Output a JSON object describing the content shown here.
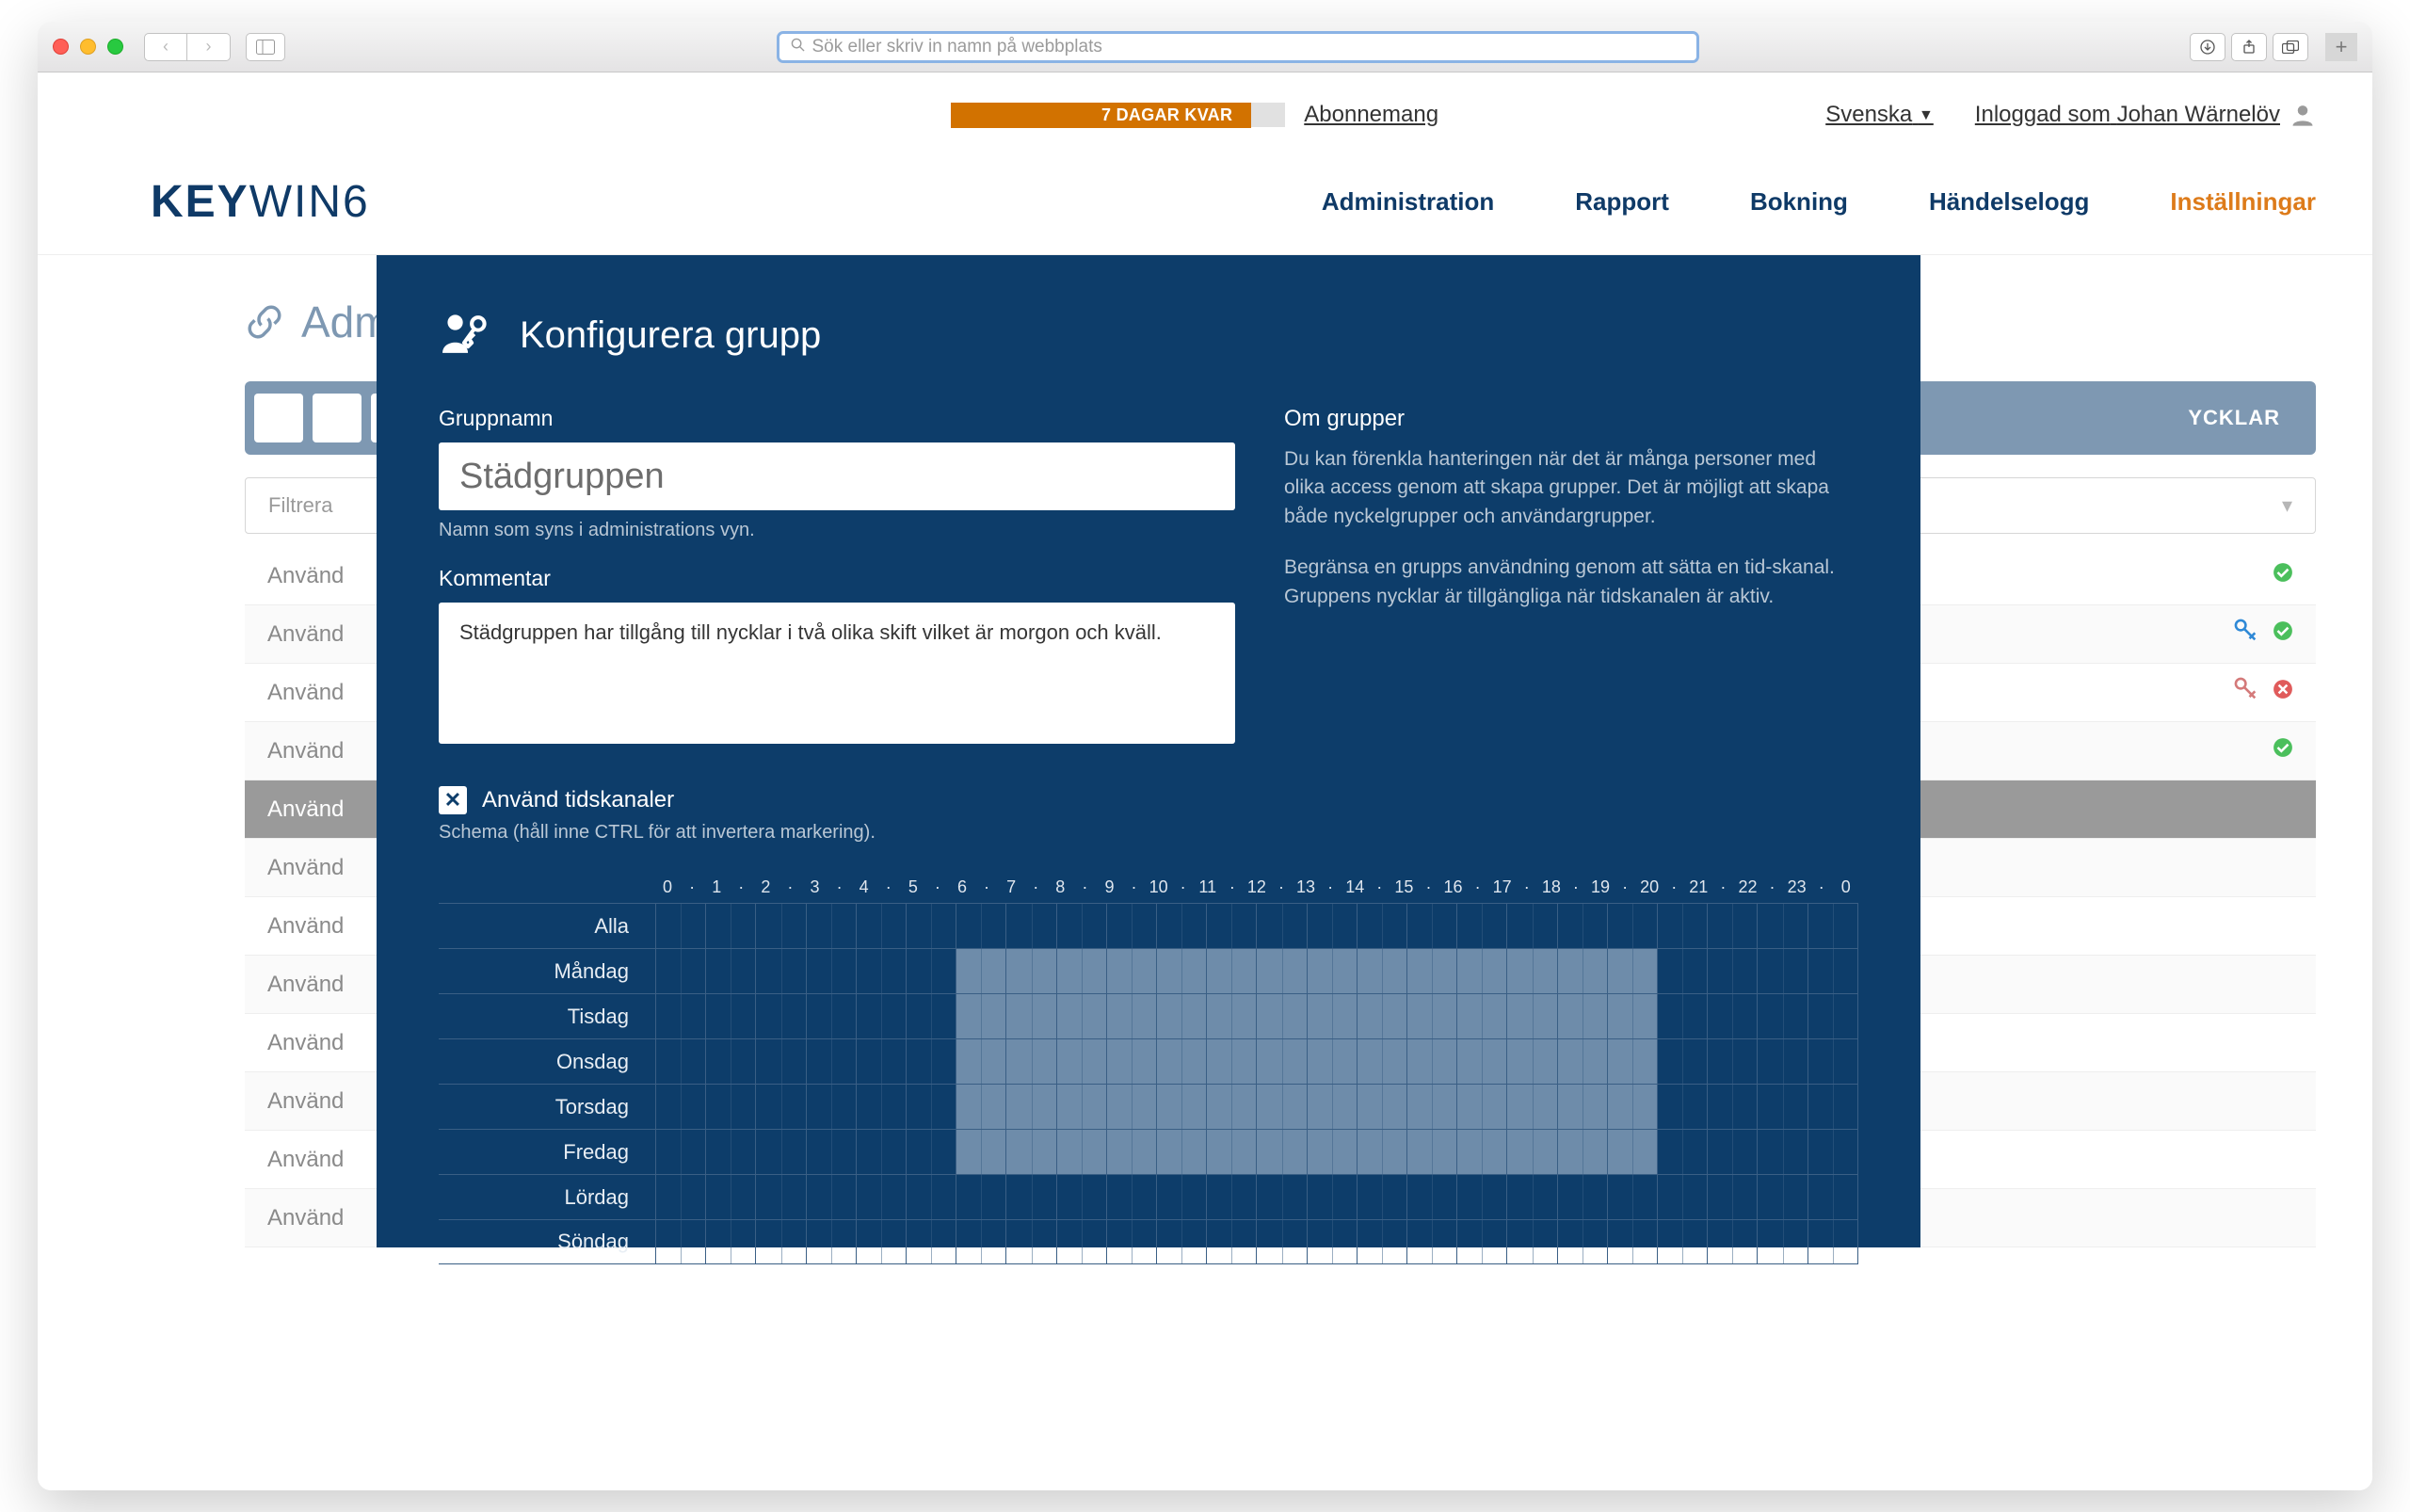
{
  "safari": {
    "placeholder": "Sök eller skriv in namn på webbplats"
  },
  "topbar": {
    "trial": "7 DAGAR KVAR",
    "subscription": "Abonnemang",
    "language": "Svenska",
    "user_prefix": "Inloggad som",
    "user_name": "Johan Wärnelöv"
  },
  "brand": {
    "strong": "KEY",
    "rest": "WIN6"
  },
  "nav": {
    "items": [
      "Administration",
      "Rapport",
      "Bokning",
      "Händelselogg",
      "Inställningar"
    ],
    "active_index": 4
  },
  "section": {
    "title_visible": "Adm"
  },
  "toolbar": {
    "right_label_visible": "YCKLAR"
  },
  "filter": {
    "placeholder_visible": "Filtrera "
  },
  "rows": [
    {
      "label": "Använd",
      "check": true,
      "key": false,
      "keycolor": "",
      "stop": false
    },
    {
      "label": "Använd",
      "check": true,
      "key": true,
      "keycolor": "#2f89d6",
      "stop": false
    },
    {
      "label": "Använd",
      "check": false,
      "key": true,
      "keycolor": "#d47a7a",
      "stop": true
    },
    {
      "label": "Använd",
      "check": true,
      "key": false,
      "keycolor": "",
      "stop": false
    },
    {
      "label": "Använd",
      "check": false,
      "key": false,
      "keycolor": "",
      "stop": false
    },
    {
      "label": "Använd",
      "check": false,
      "key": false,
      "keycolor": "",
      "stop": false
    },
    {
      "label": "Använd",
      "check": false,
      "key": false,
      "keycolor": "",
      "stop": false
    },
    {
      "label": "Använd",
      "check": false,
      "key": false,
      "keycolor": "",
      "stop": false
    },
    {
      "label": "Använd",
      "check": false,
      "key": false,
      "keycolor": "",
      "stop": false
    },
    {
      "label": "Använd",
      "check": false,
      "key": false,
      "keycolor": "",
      "stop": false
    },
    {
      "label": "Använd",
      "check": false,
      "key": false,
      "keycolor": "",
      "stop": false
    },
    {
      "label": "Använd",
      "check": false,
      "key": false,
      "keycolor": "",
      "stop": false
    }
  ],
  "selected_row_index": 4,
  "modal": {
    "title": "Konfigurera grupp",
    "groupname_label": "Gruppnamn",
    "groupname_value": "Städgruppen",
    "groupname_helper": "Namn som syns i administrations vyn.",
    "comment_label": "Kommentar",
    "comment_value": "Städgruppen har tillgång till nycklar i två olika skift vilket är morgon och kväll.",
    "about_title": "Om grupper",
    "about_p1": "Du kan förenkla hanteringen när det är många personer med olika access genom att skapa grupper. Det är möjligt att skapa både nyckelgrupper och användargrupper.",
    "about_p2": "Begränsa en grupps användning genom att sätta en tid-skanal. Gruppens nycklar är tillgängliga när tidskanalen är aktiv.",
    "use_time_label": "Använd tidskanaler",
    "use_time_checked": true,
    "sched_help": "Schema (håll inne CTRL för att invertera markering).",
    "hours_header": [
      "0",
      "·",
      "1",
      "·",
      "2",
      "·",
      "3",
      "·",
      "4",
      "·",
      "5",
      "·",
      "6",
      "·",
      "7",
      "·",
      "8",
      "·",
      "9",
      "·",
      "10",
      "·",
      "11",
      "·",
      "12",
      "·",
      "13",
      "·",
      "14",
      "·",
      "15",
      "·",
      "16",
      "·",
      "17",
      "·",
      "18",
      "·",
      "19",
      "·",
      "20",
      "·",
      "21",
      "·",
      "22",
      "·",
      "23",
      "·",
      "0"
    ],
    "days": [
      "Alla",
      "Måndag",
      "Tisdag",
      "Onsdag",
      "Torsdag",
      "Fredag",
      "Lördag",
      "Söndag"
    ],
    "active_range": {
      "from_hour": 6,
      "to_hour": 20,
      "days": [
        "Måndag",
        "Tisdag",
        "Onsdag",
        "Torsdag",
        "Fredag"
      ]
    }
  }
}
